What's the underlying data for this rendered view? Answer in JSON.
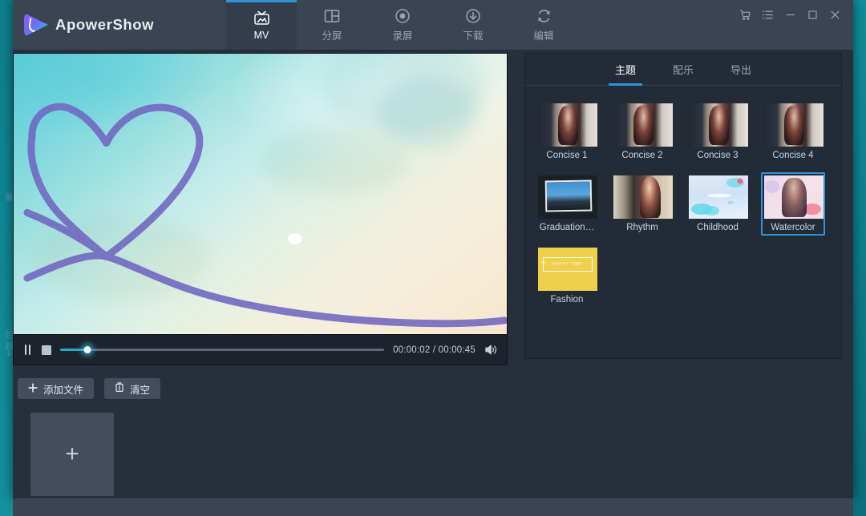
{
  "window": {
    "app_title": "ApowerShow",
    "logo_icon": "play-logo-icon"
  },
  "nav_tabs": [
    {
      "label": "MV",
      "icon": "tv-icon",
      "active": true
    },
    {
      "label": "分屏",
      "icon": "split-screen-icon",
      "active": false
    },
    {
      "label": "录屏",
      "icon": "record-icon",
      "active": false
    },
    {
      "label": "下载",
      "icon": "download-icon",
      "active": false
    },
    {
      "label": "编辑",
      "icon": "edit-refresh-icon",
      "active": false
    }
  ],
  "window_controls": [
    {
      "name": "cart-icon",
      "glyph": "cart"
    },
    {
      "name": "list-icon",
      "glyph": "list"
    },
    {
      "name": "minimize-icon",
      "glyph": "minimize"
    },
    {
      "name": "maximize-icon",
      "glyph": "maximize"
    },
    {
      "name": "close-icon",
      "glyph": "close"
    }
  ],
  "player": {
    "pause_icon": "pause-icon",
    "stop_icon": "stop-icon",
    "volume_icon": "volume-icon",
    "current_time": "00:00:02",
    "total_time": "00:00:45",
    "timecode": "00:00:02 / 00:00:45",
    "progress_percent": 5,
    "preview_alt": "watercolor heart video frame"
  },
  "actions": {
    "add_file_label": "添加文件",
    "add_file_icon": "plus-icon",
    "clear_label": "清空",
    "clear_icon": "trash-icon"
  },
  "media_strip": {
    "add_placeholder_icon": "plus-icon"
  },
  "panel": {
    "tabs": [
      {
        "label": "主题",
        "active": true
      },
      {
        "label": "配乐",
        "active": false
      },
      {
        "label": "导出",
        "active": false
      }
    ],
    "themes": [
      {
        "label": "Concise 1",
        "art": "th-concise",
        "selected": false
      },
      {
        "label": "Concise 2",
        "art": "th-concise",
        "selected": false
      },
      {
        "label": "Concise 3",
        "art": "th-concise",
        "selected": false
      },
      {
        "label": "Concise 4",
        "art": "th-concise",
        "selected": false
      },
      {
        "label": "Graduation…",
        "art": "th-grad",
        "selected": false
      },
      {
        "label": "Rhythm",
        "art": "th-rhythm",
        "selected": false
      },
      {
        "label": "Childhood",
        "art": "th-child",
        "selected": false
      },
      {
        "label": "Watercolor",
        "art": "th-water",
        "selected": true
      },
      {
        "label": "Fashion",
        "art": "th-fashion",
        "selected": false,
        "overlay_text": "HAPPY TIME"
      }
    ]
  },
  "desktop": {
    "background_color": "#14909e",
    "icons": [
      {
        "glyph": "▣",
        "label": ""
      },
      {
        "glyph": "▤",
        "label": ""
      },
      {
        "glyph": "▦",
        "label": "P"
      }
    ]
  },
  "colors": {
    "accent": "#2f93d8",
    "titlebar": "#3b4452",
    "panel_bg": "#232b36",
    "app_bg": "#262f3b",
    "seek_fill": "#29a8c9"
  }
}
